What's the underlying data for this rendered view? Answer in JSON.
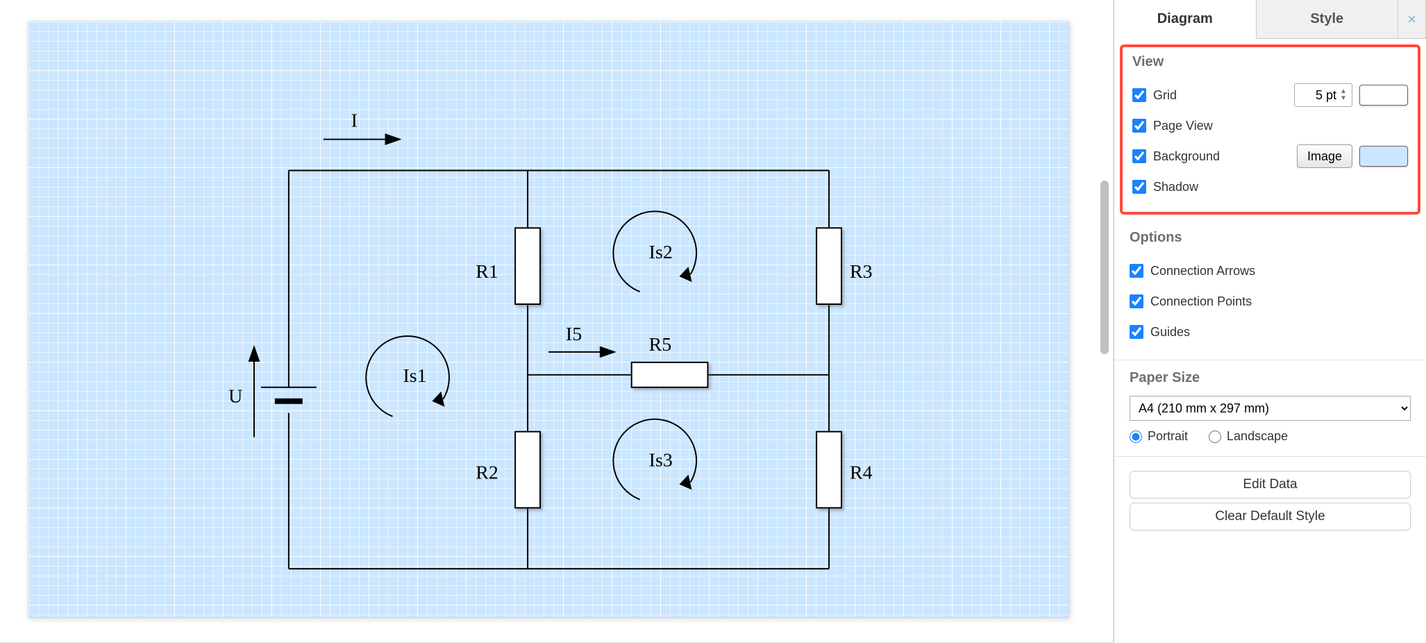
{
  "tabs": {
    "diagram": "Diagram",
    "style": "Style"
  },
  "view": {
    "title": "View",
    "grid": "Grid",
    "grid_value": "5 pt",
    "page_view": "Page View",
    "background": "Background",
    "image_btn": "Image",
    "shadow": "Shadow",
    "grid_checked": true,
    "page_view_checked": true,
    "background_checked": true,
    "shadow_checked": true
  },
  "options": {
    "title": "Options",
    "connection_arrows": "Connection Arrows",
    "connection_points": "Connection Points",
    "guides": "Guides",
    "connection_arrows_checked": true,
    "connection_points_checked": true,
    "guides_checked": true
  },
  "paper": {
    "title": "Paper Size",
    "selected": "A4 (210 mm x 297 mm)",
    "portrait": "Portrait",
    "landscape": "Landscape",
    "orientation": "portrait"
  },
  "buttons": {
    "edit_data": "Edit Data",
    "clear_style": "Clear Default Style"
  },
  "circuit": {
    "I": "I",
    "I5": "I5",
    "U": "U",
    "R1": "R1",
    "R2": "R2",
    "R3": "R3",
    "R4": "R4",
    "R5": "R5",
    "Is1": "Is1",
    "Is2": "Is2",
    "Is3": "Is3"
  }
}
